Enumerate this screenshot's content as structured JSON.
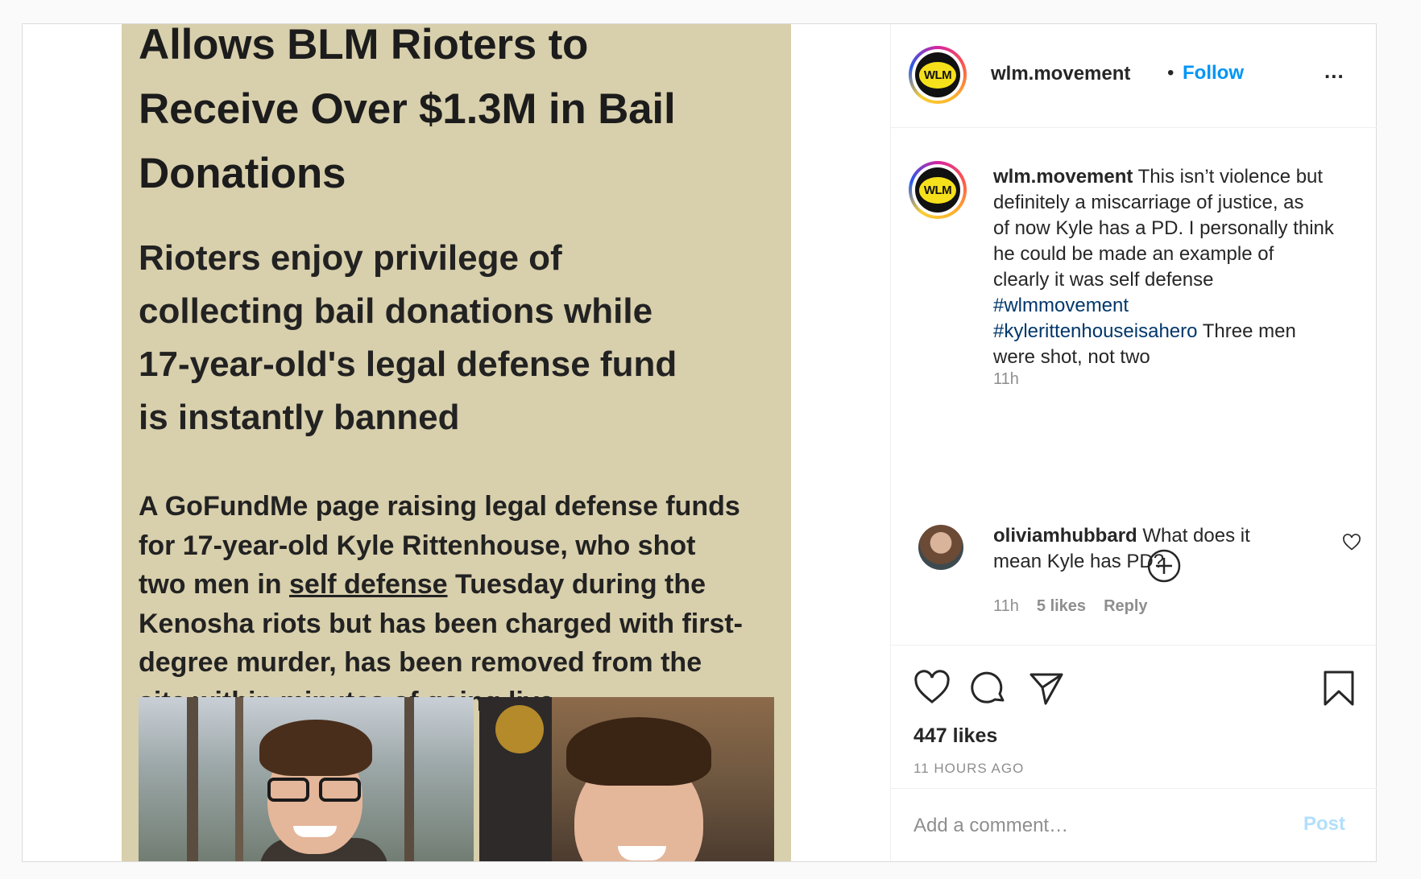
{
  "post": {
    "article": {
      "headline_lines": [
        "Allows BLM Rioters to",
        "Receive Over $1.3M in Bail",
        "Donations"
      ],
      "subhead_lines": [
        "Rioters enjoy privilege of",
        "collecting bail donations while",
        "17-year-old's legal defense fund",
        "is instantly banned"
      ],
      "body_lines": [
        "A GoFundMe page raising legal defense funds",
        "for 17-year-old Kyle Rittenhouse, who shot",
        "Kenosha riots but has been charged with first-",
        "degree murder, has been removed from the",
        "site within minutes of going live."
      ],
      "body_line3": {
        "before": "two men in ",
        "underlined": "self defense",
        "after": " Tuesday during the"
      }
    },
    "header": {
      "username": "wlm.movement",
      "dot": "•",
      "follow_label": "Follow",
      "more_label": "...",
      "avatar_text": "WLM"
    },
    "caption": {
      "username": "wlm.movement",
      "line1_rest": " This isn’t violence but",
      "lines": [
        "definitely a miscarriage of justice, as",
        "of now Kyle has a PD. I personally think",
        "he could be made an example of",
        "clearly it was self defense"
      ],
      "hashtag1": "#wlmmovement",
      "hashtag2": "#kylerittenhouseisahero",
      "after_hashtag2": " Three men",
      "last_line": "were shot, not two",
      "time": "11h"
    },
    "comment": {
      "username": "oliviamhubbard",
      "text_rest": " What does it",
      "line2": "mean Kyle has PD?",
      "time": "11h",
      "likes": "5 likes",
      "reply": "Reply"
    },
    "actions": {
      "likes_count": "447 likes",
      "time_ago": "11 HOURS AGO"
    },
    "comment_box": {
      "placeholder": "Add a comment…",
      "post_label": "Post"
    },
    "colors": {
      "link_blue": "#0095f6",
      "hashtag_blue": "#00376b",
      "article_bg": "#d8cfac",
      "post_disabled": "#b2dffc"
    }
  }
}
